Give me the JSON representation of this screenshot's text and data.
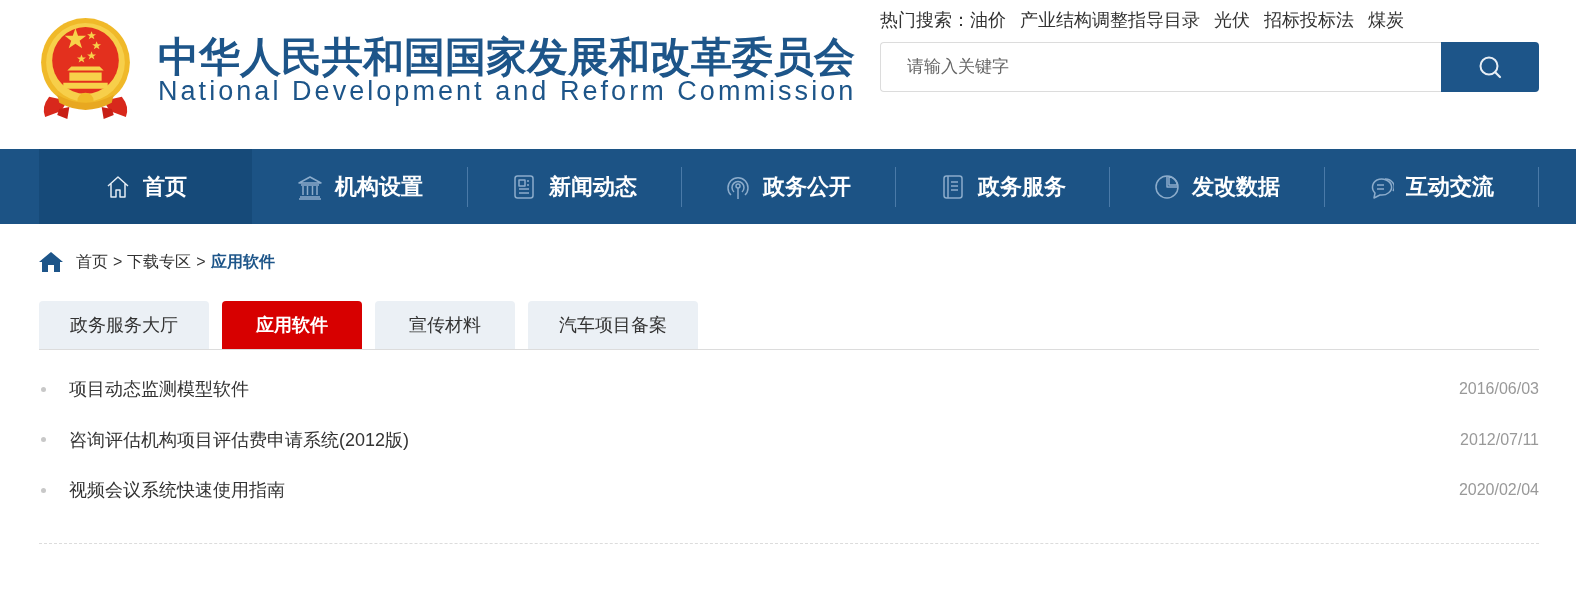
{
  "header": {
    "title": "中华人民共和国国家发展和改革委员会",
    "subtitle": "National Development and Reform Commission"
  },
  "hot_search": {
    "label": "热门搜索：",
    "terms": [
      "油价",
      "产业结构调整指导目录",
      "光伏",
      "招标投标法",
      "煤炭"
    ]
  },
  "search": {
    "placeholder": "请输入关键字"
  },
  "nav": [
    {
      "label": "首页",
      "selected": true
    },
    {
      "label": "机构设置",
      "selected": false
    },
    {
      "label": "新闻动态",
      "selected": false
    },
    {
      "label": "政务公开",
      "selected": false
    },
    {
      "label": "政务服务",
      "selected": false
    },
    {
      "label": "发改数据",
      "selected": false
    },
    {
      "label": "互动交流",
      "selected": false
    }
  ],
  "breadcrumb": [
    {
      "label": "首页",
      "separator": ">",
      "current": false
    },
    {
      "label": "下载专区",
      "separator": ">",
      "current": false
    },
    {
      "label": "应用软件",
      "current": true
    }
  ],
  "tabs": [
    {
      "label": "政务服务大厅",
      "selected": false
    },
    {
      "label": "应用软件",
      "selected": true
    },
    {
      "label": "宣传材料",
      "selected": false
    },
    {
      "label": "汽车项目备案",
      "selected": false
    }
  ],
  "items": [
    {
      "title": "项目动态监测模型软件",
      "date": "2016/06/03"
    },
    {
      "title": "咨询评估机构项目评估费申请系统(2012版)",
      "date": "2012/07/11"
    },
    {
      "title": "视频会议系统快速使用指南",
      "date": "2020/02/04"
    }
  ]
}
